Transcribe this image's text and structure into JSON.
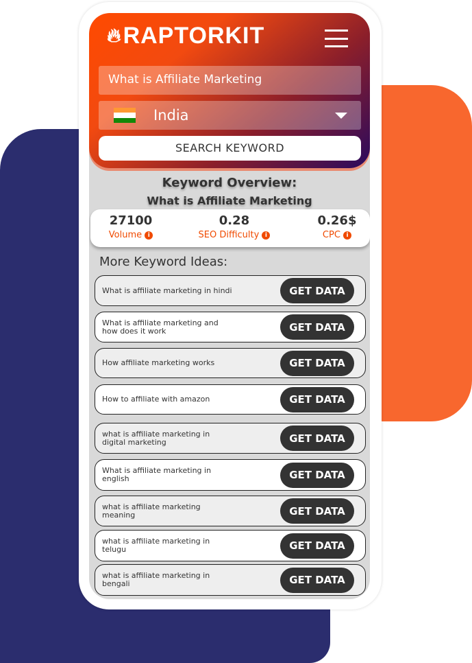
{
  "brand": {
    "name": "RAPTORKIT",
    "accent": "#f04a00",
    "navy": "#2b2d6e",
    "orange": "#f8672e"
  },
  "search": {
    "keyword_value": "What is Affiliate Marketing",
    "country": "India",
    "button": "SEARCH KEYWORD"
  },
  "overview": {
    "title": "Keyword Overview:",
    "keyword": "What is Affiliate Marketing",
    "metrics": [
      {
        "value": "27100",
        "label": "Volume"
      },
      {
        "value": "0.28",
        "label": "SEO Difficulty"
      },
      {
        "value": "0.26$",
        "label": "CPC"
      }
    ]
  },
  "ideas": {
    "title": "More Keyword Ideas:",
    "button": "GET DATA",
    "items": [
      "What is affiliate marketing in hindi",
      "What is affiliate marketing and how does it work",
      "How affiliate marketing works",
      "How to affiliate with amazon",
      "what is affiliate marketing in digital marketing",
      "What is affiliate marketing in english",
      "what is affiliate marketing meaning",
      "what is affiliate marketing in telugu",
      "what is affiliate marketing in bengali"
    ]
  }
}
